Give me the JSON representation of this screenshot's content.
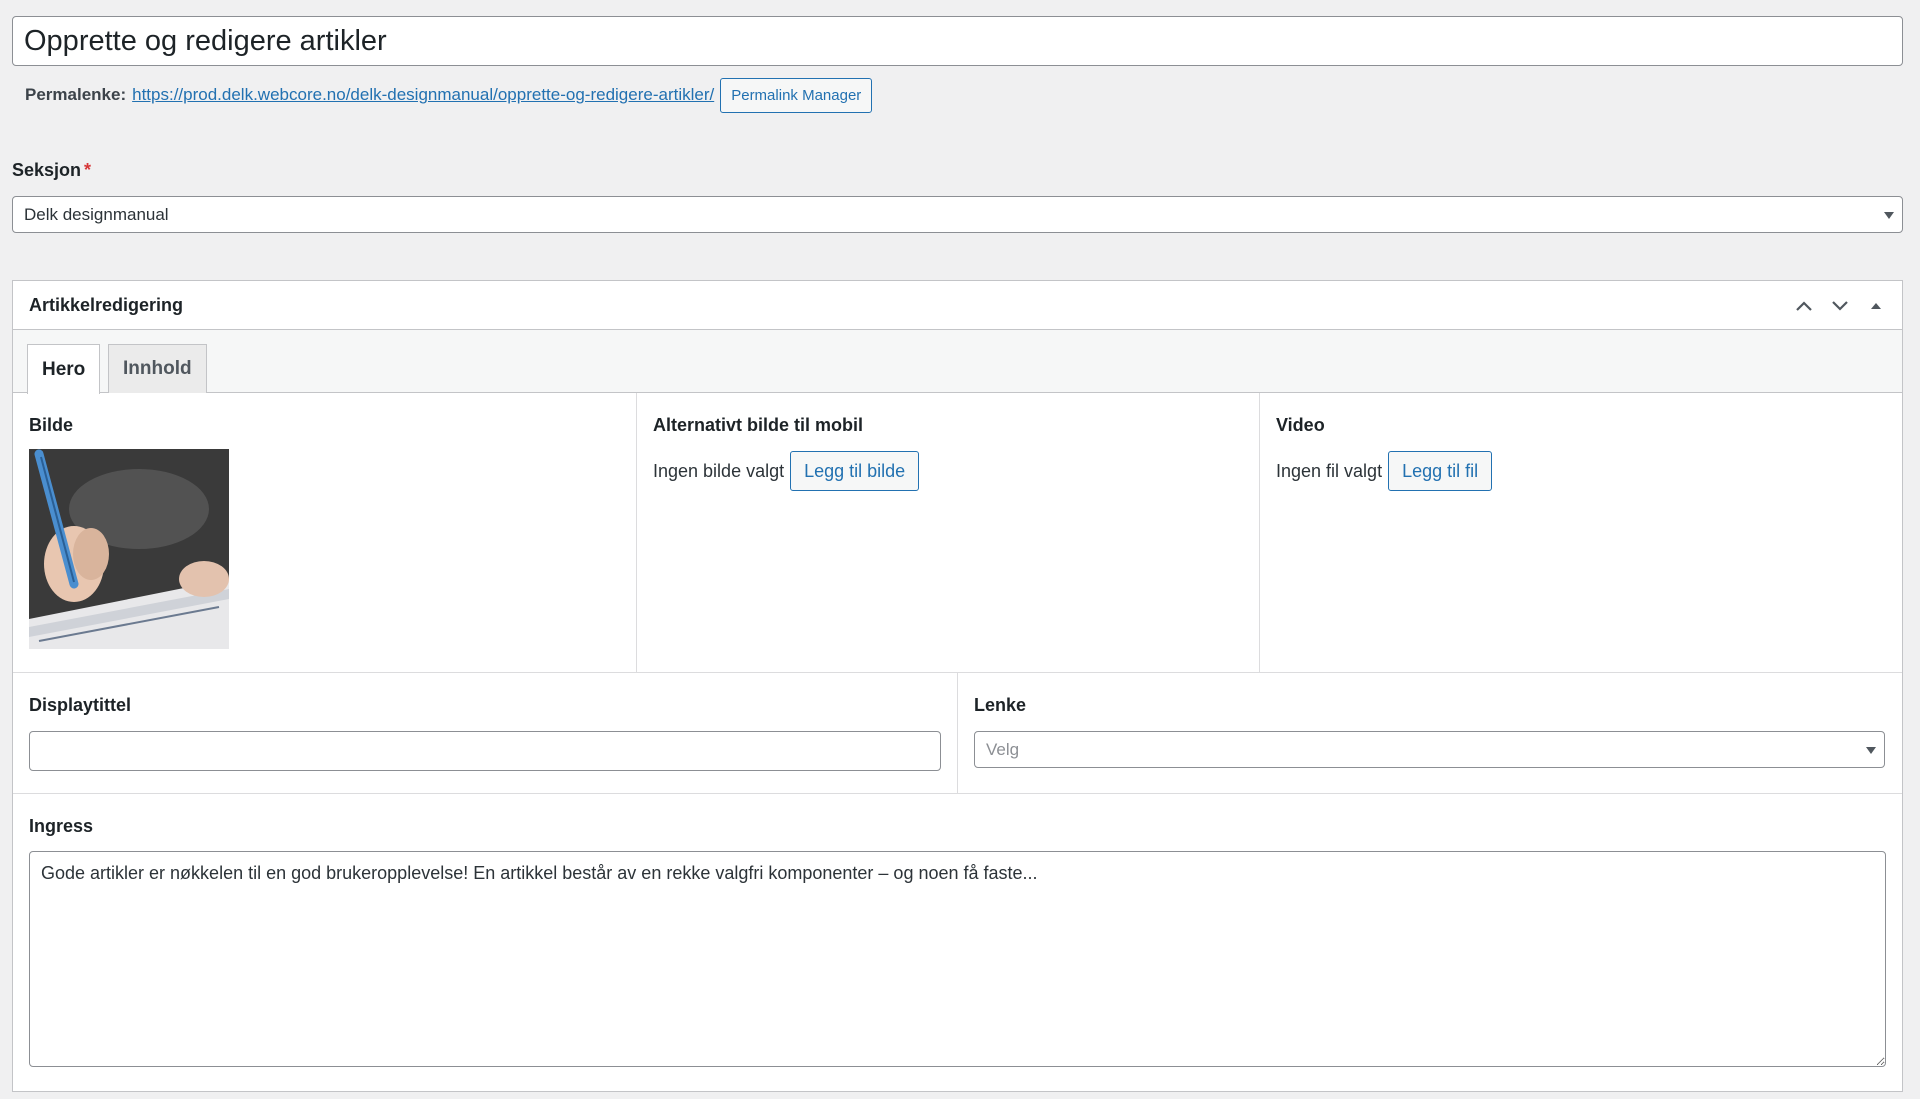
{
  "post": {
    "title": "Opprette og redigere artikler"
  },
  "permalink": {
    "label": "Permalenke:",
    "url": "https://prod.delk.webcore.no/delk-designmanual/opprette-og-redigere-artikler/",
    "manager_button": "Permalink Manager"
  },
  "section": {
    "label": "Seksjon",
    "required_marker": "*",
    "selected": "Delk designmanual"
  },
  "metabox": {
    "title": "Artikkelredigering",
    "tabs": [
      {
        "label": "Hero",
        "active": true
      },
      {
        "label": "Innhold",
        "active": false
      }
    ],
    "image": {
      "label": "Bilde"
    },
    "mobile_image": {
      "label": "Alternativt bilde til mobil",
      "status": "Ingen bilde valgt",
      "button": "Legg til bilde"
    },
    "video": {
      "label": "Video",
      "status": "Ingen fil valgt",
      "button": "Legg til fil"
    },
    "display_title": {
      "label": "Displaytittel",
      "value": ""
    },
    "link": {
      "label": "Lenke",
      "selected": "Velg"
    },
    "lead": {
      "label": "Ingress",
      "value": "Gode artikler er nøkkelen til en god brukeropplevelse! En artikkel består av en rekke valgfri komponenter – og noen få faste..."
    }
  },
  "icons": {
    "move_up": "chevron-up-icon",
    "move_down": "chevron-down-icon",
    "toggle": "caret-up-icon",
    "dropdown": "caret-down-icon"
  },
  "colors": {
    "background": "#f0f0f1",
    "accent": "#2271b1",
    "required": "#d63638",
    "border": "#8c8f94"
  }
}
